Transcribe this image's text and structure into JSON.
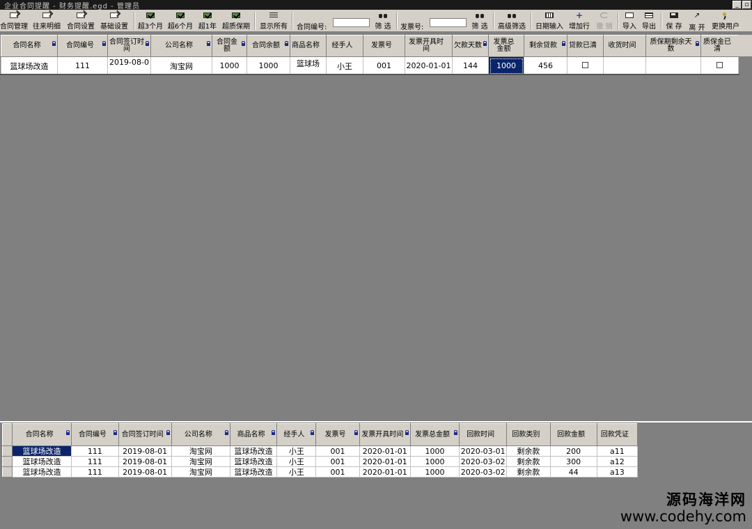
{
  "window": {
    "title": "企业合同提醒 - 财务提醒.egd - 管理员",
    "min_glyph": "_",
    "restore_glyph": "▫"
  },
  "toolbar": {
    "contract_mgmt": "合同管理",
    "history": "往来明细",
    "contract_settings": "合同设置",
    "base_settings": "基础设置",
    "over3m": "超3个月",
    "over6m": "超6个月",
    "over1y": "超1年",
    "over_warranty": "超质保期",
    "show_all": "显示所有",
    "contract_no_label": "合同编号:",
    "contract_no_value": "",
    "filter1": "筛 选",
    "invoice_no_label": "发票号:",
    "invoice_no_value": "",
    "filter2": "筛 选",
    "adv_filter": "高级筛选",
    "date_input": "日期输入",
    "add_row": "增加行",
    "undo": "撤 销",
    "import": "导入",
    "export": "导出",
    "save": "保 存",
    "leave": "离 开",
    "change_user": "更换用户"
  },
  "grid1": {
    "columns": [
      "合同名称",
      "合同编号",
      "合同签订时间",
      "公司名称",
      "合同金额",
      "合同余额",
      "商品名称",
      "经手人",
      "发票号",
      "发票开具时间",
      "欠款天数",
      "发票总金额",
      "剩余贷款",
      "贷款已清",
      "收货时间",
      "质保期剩余天数",
      "质保金已清"
    ],
    "row": [
      "篮球场改造",
      "111",
      "2019-08-0",
      "淘宝网",
      "1000",
      "1000",
      "篮球场",
      "小王",
      "001",
      "2020-01-01",
      "144",
      "1000",
      "456",
      "",
      "",
      "",
      ""
    ]
  },
  "grid2": {
    "columns": [
      "合同名称",
      "合同编号",
      "合同签订时间",
      "公司名称",
      "商品名称",
      "经手人",
      "发票号",
      "发票开具时间",
      "发票总金额",
      "回款时间",
      "回款类别",
      "回款金额",
      "回款凭证"
    ],
    "rows": [
      [
        "篮球场改造",
        "111",
        "2019-08-01",
        "淘宝网",
        "篮球场改造",
        "小王",
        "001",
        "2020-01-01",
        "1000",
        "2020-03-01",
        "剩余款",
        "200",
        "a11"
      ],
      [
        "篮球场改造",
        "111",
        "2019-08-01",
        "淘宝网",
        "篮球场改造",
        "小王",
        "001",
        "2020-01-01",
        "1000",
        "2020-03-02",
        "剩余款",
        "300",
        "a12"
      ],
      [
        "篮球场改造",
        "111",
        "2019-08-01",
        "淘宝网",
        "篮球场改造",
        "小王",
        "001",
        "2020-01-01",
        "1000",
        "2020-03-02",
        "剩余款",
        "44",
        "a13"
      ]
    ]
  },
  "watermark": {
    "line1": "源码海洋网",
    "line2": "www.codehy.com"
  }
}
